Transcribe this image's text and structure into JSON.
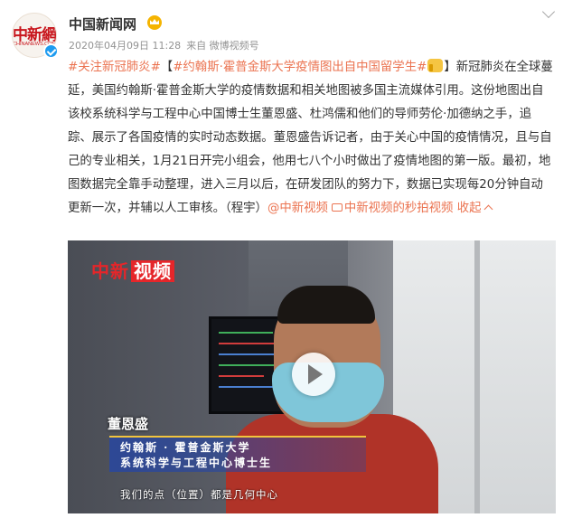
{
  "post": {
    "avatar_logo": "中新網",
    "avatar_sub": "CHINANEWS.COM",
    "author": "中国新闻网",
    "timestamp": "2020年04月09日 11:28",
    "source": "来自 微博视频号"
  },
  "content": {
    "hashtag1": "#关注新冠肺炎#",
    "bracket_open": "【",
    "hashtag2": "#约翰斯·霍普金斯大学疫情图出自中国留学生#",
    "bracket_close": "】",
    "paragraph": "新冠肺炎在全球蔓延，美国约翰斯·霍普金斯大学的疫情数据和相关地图被多国主流媒体引用。这份地图出自该校系统科学与工程中心中国博士生董恩盛、杜鸿儒和他们的导师劳伦·加德纳之手，追踪、展示了各国疫情的实时动态数据。董恩盛告诉记者，由于关心中国的疫情情况，且与自己的专业相关，1月21日开完小组会，他用七八个小时做出了疫情地图的第一版。最初，地图数据完全靠手动整理，进入三月以后，在研发团队的努力下，数据已实现每20分钟自动更新一次，并辅以人工审核。（程宇）",
    "mention": "@中新视频",
    "video_link": "中新视频的秒拍视频",
    "collapse": "收起"
  },
  "video": {
    "logo_text": "中新",
    "logo_tv": "视频",
    "person_name": "董恩盛",
    "title_line1": "约翰斯 · 霍普金斯大学",
    "title_line2": "系统科学与工程中心博士生",
    "subtitle": "我们的点（位置）都是几何中心"
  },
  "colors": {
    "link": "#eb7350",
    "verified": "#1d9bf0",
    "title_bar": "#2846a0"
  }
}
